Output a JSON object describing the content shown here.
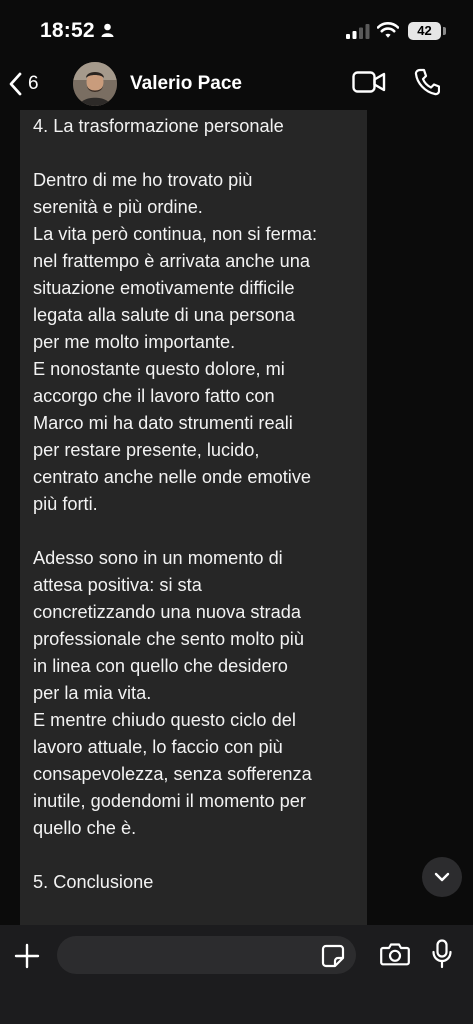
{
  "status_bar": {
    "time": "18:52",
    "battery": "42"
  },
  "header": {
    "back_count": "6",
    "contact_name": "Valerio Pace"
  },
  "message": {
    "paragraphs": [
      [
        "4. La trasformazione personale"
      ],
      [
        "Dentro di me ho trovato più",
        "serenità e più ordine.",
        "La vita però continua, non si ferma:",
        "nel frattempo è arrivata anche una",
        "situazione emotivamente difficile",
        "legata alla salute di una persona",
        "per me molto importante.",
        "E nonostante questo dolore, mi",
        "accorgo che il lavoro fatto con",
        "Marco mi ha dato strumenti reali",
        "per restare presente, lucido,",
        "centrato anche nelle onde emotive",
        "più forti."
      ],
      [
        "Adesso sono in un momento di",
        "attesa positiva: si sta",
        "concretizzando una nuova strada",
        "professionale che sento molto più",
        "in linea con quello che desidero",
        "per la mia vita.",
        "E mentre chiudo questo ciclo del",
        "lavoro attuale, lo faccio con più",
        "consapevolezza, senza sofferenza",
        "inutile, godendomi il momento per",
        "quello che è."
      ],
      [
        "5. Conclusione"
      ]
    ]
  },
  "composer": {
    "value": ""
  },
  "icons": {
    "person": "person-icon",
    "signal": "signal-icon",
    "wifi": "wifi-icon",
    "back": "chevron-left-icon",
    "video": "video-camera-icon",
    "call": "phone-icon",
    "scroll": "chevron-down-icon",
    "plus": "plus-icon",
    "sticker": "sticker-icon",
    "camera": "camera-icon",
    "mic": "microphone-icon"
  },
  "colors": {
    "background": "#0b0b0b",
    "bubble": "#262626",
    "composer": "#1c1c1e"
  }
}
